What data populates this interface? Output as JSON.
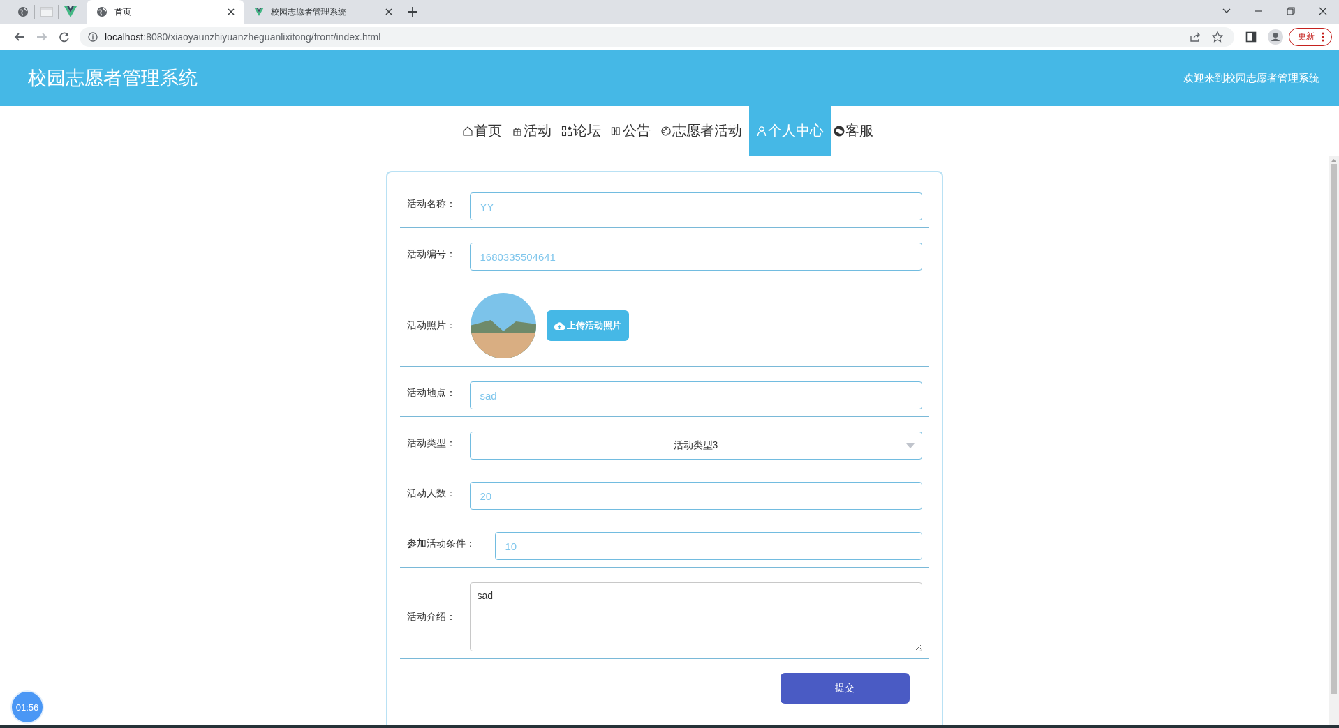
{
  "browser": {
    "tabs": [
      {
        "title": "首页",
        "selected": true
      },
      {
        "title": "校园志愿者管理系统",
        "selected": false
      }
    ],
    "url_host": "localhost",
    "url_rest": ":8080/xiaoyaunzhiyuanzheguanlixitong/front/index.html",
    "update_button": "更新"
  },
  "header": {
    "title": "校园志愿者管理系统",
    "welcome": "欢迎来到校园志愿者管理系统"
  },
  "nav": [
    {
      "label": "首页",
      "selected": false
    },
    {
      "label": "活动",
      "selected": false
    },
    {
      "label": "论坛",
      "selected": false
    },
    {
      "label": "公告",
      "selected": false
    },
    {
      "label": "志愿者活动",
      "selected": false
    },
    {
      "label": "个人中心",
      "selected": true
    },
    {
      "label": "客服",
      "selected": false
    }
  ],
  "form": {
    "fields": [
      {
        "kind": "text",
        "label": "活动名称：",
        "value": "YY"
      },
      {
        "kind": "text",
        "label": "活动编号：",
        "value": "1680335504641"
      },
      {
        "kind": "image",
        "label": "活动照片：",
        "button": "上传活动照片"
      },
      {
        "kind": "text",
        "label": "活动地点：",
        "value": "sad"
      },
      {
        "kind": "select",
        "label": "活动类型：",
        "value": "活动类型3"
      },
      {
        "kind": "text",
        "label": "活动人数：",
        "value": "20"
      },
      {
        "kind": "text",
        "label": "参加活动条件：",
        "value": "10"
      },
      {
        "kind": "textarea",
        "label": "活动介绍：",
        "value": "sad"
      }
    ],
    "submit": "提交"
  },
  "timer": "01:56"
}
